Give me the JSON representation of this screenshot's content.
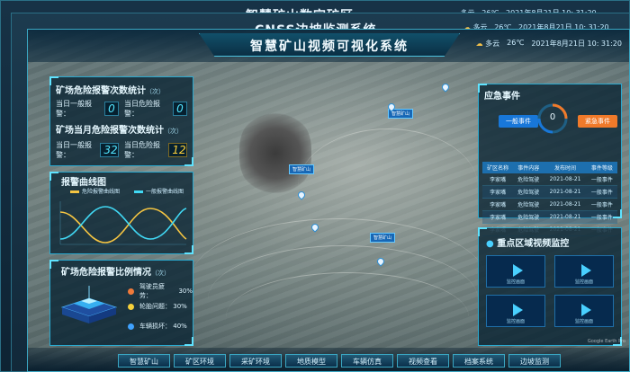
{
  "back_screens": [
    {
      "title": "智慧矿山数字矿区",
      "weather": "多云",
      "temp": "26℃",
      "datetime": "2021年8月21日 10: 31:20"
    },
    {
      "title": "CNSS边坡监测系统",
      "weather": "多云",
      "temp": "26℃",
      "datetime": "2021年8月21日 10: 31:20"
    }
  ],
  "header": {
    "title": "智慧矿山视频可视化系统",
    "weather": "多云",
    "temp": "26℃",
    "datetime": "2021年8月21日 10: 31:20"
  },
  "stats": {
    "title": "矿场危险报警次数统计",
    "unit": "（次）",
    "today_general_label": "当日一般报警：",
    "today_general_value": "0",
    "today_severe_label": "当日危险报警：",
    "today_severe_value": "0",
    "month_title": "矿场当月危险报警次数统计",
    "month_unit": "（次）",
    "month_general_label": "当日一般报警：",
    "month_general_value": "32",
    "month_severe_label": "当日危险报警：",
    "month_severe_value": "12"
  },
  "curve": {
    "title": "报警曲线图",
    "legend": [
      "危险报警曲线图",
      "一般报警曲线图"
    ],
    "colors": [
      "#f5c542",
      "#41d9f5"
    ]
  },
  "ratio": {
    "title": "矿场危险报警比例情况",
    "unit": "（次）",
    "items": [
      {
        "label": "驾驶员疲劳：",
        "value": "30%",
        "color": "#f07a3a"
      },
      {
        "label": "轮胎问题：",
        "value": "30%",
        "color": "#f5d03a"
      },
      {
        "label": "车辆损坏：",
        "value": "40%",
        "color": "#3fa2ff"
      }
    ]
  },
  "emergency": {
    "title": "应急事件",
    "general_btn": "一般事件",
    "urgent_btn": "紧急事件",
    "gauge_value": "0",
    "headers": [
      "矿区名称",
      "事件内容",
      "发布时间",
      "事件等级"
    ],
    "rows": [
      [
        "李家嘴",
        "危险驾驶",
        "2021-08-21",
        "一般事件"
      ],
      [
        "李家嘴",
        "危险驾驶",
        "2021-08-21",
        "一般事件"
      ],
      [
        "李家嘴",
        "危险驾驶",
        "2021-08-21",
        "一般事件"
      ],
      [
        "李家嘴",
        "危险驾驶",
        "2021-08-21",
        "一般事件"
      ],
      [
        "李家嘴",
        "危险驾驶",
        "2021-08-21",
        "一般事件"
      ]
    ]
  },
  "monitor": {
    "title": "重点区域视频监控",
    "videos": [
      "监控画面",
      "监控画面",
      "监控画面",
      "监控画面"
    ]
  },
  "markers": [
    "智慧矿山",
    "智慧矿山",
    "智慧矿山"
  ],
  "nav": [
    "智慧矿山",
    "矿区环境",
    "采矿环境",
    "地质模型",
    "车辆仿真",
    "视频查看",
    "档案系统",
    "边坡监测"
  ],
  "watermark": "Google Earth Pro"
}
